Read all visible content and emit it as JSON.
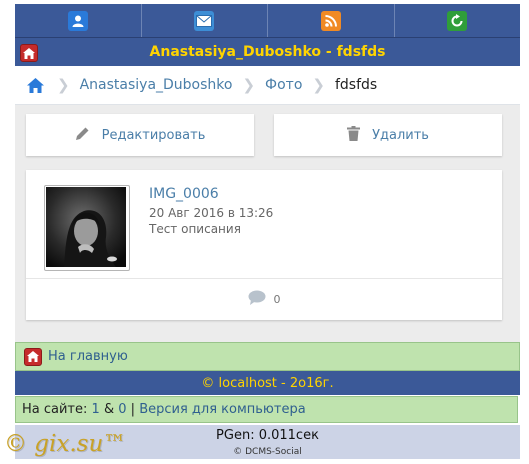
{
  "colors": {
    "header_blue": "#3b5998",
    "title_yellow": "#ffd400",
    "green_bar": "#bfe3ae",
    "link_blue": "#4a7ea8",
    "footer_lavender": "#ccd3e6"
  },
  "topbar": {
    "icons": [
      "user-icon",
      "mail-icon",
      "rss-icon",
      "refresh-icon"
    ]
  },
  "header": {
    "title": "Anastasiya_Duboshko - fdsfds"
  },
  "breadcrumb": {
    "items": [
      "Anastasiya_Duboshko",
      "Фото"
    ],
    "current": "fdsfds"
  },
  "actions": {
    "edit_label": "Редактировать",
    "delete_label": "Удалить"
  },
  "photo": {
    "name": "IMG_0006",
    "date": "20 Авг 2016 в 13:26",
    "description": "Тест описания",
    "comments_count": "0"
  },
  "nav": {
    "home_link": "На главную"
  },
  "footer": {
    "copyright": "© localhost - 2o16г.",
    "online_prefix": "На сайте:",
    "online_users": "1",
    "online_amp": "&",
    "online_guests": "0",
    "online_sep": "|",
    "desktop_version": "Версия для компьютера",
    "pgen": "PGen: 0.011сек",
    "credit": "© DCMS-Social"
  },
  "watermark": "© gix.su™"
}
